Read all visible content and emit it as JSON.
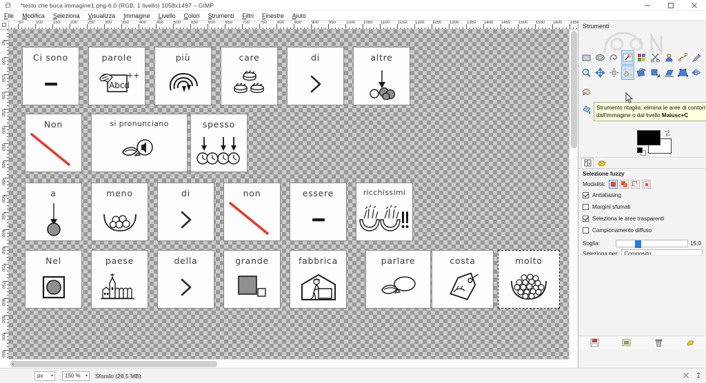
{
  "window": {
    "title": "*testo che buca immagine1.png-6.0 (RGB, 1 livello) 1058x1497 – GIMP",
    "app_icon": "gimp-icon",
    "minimize_label": "–",
    "maximize_label": "▢",
    "close_label": "✕"
  },
  "menubar": {
    "items": [
      {
        "label": "File"
      },
      {
        "label": "Modifica"
      },
      {
        "label": "Seleziona"
      },
      {
        "label": "Visualizza"
      },
      {
        "label": "Immagine"
      },
      {
        "label": "Livello"
      },
      {
        "label": "Colori"
      },
      {
        "label": "Strumenti"
      },
      {
        "label": "Filtri"
      },
      {
        "label": "Finestre"
      },
      {
        "label": "Aiuto"
      }
    ]
  },
  "rulers": {
    "horizontal_labels": [
      "50",
      "100",
      "150",
      "200",
      "250",
      "300",
      "350",
      "400",
      "450",
      "500",
      "550",
      "600",
      "650",
      "700",
      "750",
      "800",
      "850",
      "900",
      "950",
      "1000"
    ],
    "vertical_labels": [
      "50",
      "100",
      "150",
      "200",
      "250",
      "300",
      "350",
      "400",
      "450",
      "500",
      "550",
      "600",
      "650"
    ],
    "unit_step": 50
  },
  "canvas": {
    "cards": [
      {
        "label": "Ci sono",
        "icon": "minus-dash-icon",
        "row": 1,
        "selected": false
      },
      {
        "label": "parole",
        "icon": "hand-writing-abcd-icon",
        "row": 1,
        "selected": false
      },
      {
        "label": "più",
        "icon": "swirl-arcs-icon",
        "row": 1,
        "selected": false
      },
      {
        "label": "care",
        "icon": "coins-stacks-icon",
        "row": 1,
        "selected": false
      },
      {
        "label": "di",
        "icon": "greater-than-icon",
        "row": 1,
        "selected": false
      },
      {
        "label": "altre",
        "icon": "arrow-down-circles-icon",
        "row": 1,
        "selected": false
      },
      {
        "label": "Non",
        "icon": "red-slash-icon",
        "row": 2,
        "selected": false
      },
      {
        "label": "si pronunciano",
        "icon": "mouth-speaker-icon",
        "row": 2,
        "selected": false
      },
      {
        "label": "spesso",
        "icon": "arrows-clocks-icon",
        "row": 2,
        "selected": false
      },
      {
        "label": "a",
        "icon": "arrow-down-ball-icon",
        "row": 3,
        "selected": false
      },
      {
        "label": "meno",
        "icon": "bowl-few-balls-icon",
        "row": 3,
        "selected": false
      },
      {
        "label": "di",
        "icon": "greater-than-icon",
        "row": 3,
        "selected": false
      },
      {
        "label": "non",
        "icon": "red-slash-icon",
        "row": 3,
        "selected": false
      },
      {
        "label": "essere",
        "icon": "minus-dash-icon",
        "row": 3,
        "selected": false
      },
      {
        "label": "ricchissimi",
        "icon": "hands-money-excl-icon",
        "row": 3,
        "selected": false
      },
      {
        "label": "Nel",
        "icon": "square-in-square-icon",
        "row": 4,
        "selected": false
      },
      {
        "label": "paese",
        "icon": "village-church-icon",
        "row": 4,
        "selected": false
      },
      {
        "label": "della",
        "icon": "greater-than-icon",
        "row": 4,
        "selected": false
      },
      {
        "label": "grande",
        "icon": "big-small-square-icon",
        "row": 4,
        "selected": false
      },
      {
        "label": "fabbrica",
        "icon": "factory-worker-icon",
        "row": 4,
        "selected": false
      },
      {
        "label": "parlare",
        "icon": "mouth-bubble-icon",
        "row": 4,
        "selected": false
      },
      {
        "label": "costa",
        "icon": "price-tag-icon",
        "row": 4,
        "selected": false
      },
      {
        "label": "molto",
        "icon": "bowl-many-balls-icon",
        "row": 4,
        "selected": true
      }
    ]
  },
  "dock": {
    "title": "Strumenti",
    "tools_row1": [
      {
        "name": "rectangle-select-tool",
        "active": false
      },
      {
        "name": "ellipse-select-tool",
        "active": false
      },
      {
        "name": "free-select-tool",
        "active": false
      },
      {
        "name": "fuzzy-select-tool",
        "active": true
      },
      {
        "name": "select-by-color-tool",
        "active": false
      },
      {
        "name": "scissors-select-tool",
        "active": false
      },
      {
        "name": "foreground-select-tool",
        "active": false
      },
      {
        "name": "paths-tool",
        "active": false
      },
      {
        "name": "color-picker-tool",
        "active": false
      }
    ],
    "tools_row2": [
      {
        "name": "zoom-tool",
        "active": false
      },
      {
        "name": "move-tool",
        "active": false
      },
      {
        "name": "align-tool",
        "active": false
      },
      {
        "name": "crop-tool",
        "active": true
      },
      {
        "name": "rotate-tool",
        "active": false
      },
      {
        "name": "scale-tool",
        "active": false
      },
      {
        "name": "shear-tool",
        "active": false
      },
      {
        "name": "perspective-tool",
        "active": false
      },
      {
        "name": "flip-tool",
        "active": false
      }
    ],
    "tools_col": [
      {
        "name": "warp-transform-tool"
      },
      {
        "name": "bucket-fill-tool"
      }
    ],
    "tooltip": {
      "text": "Strumento ritaglia: elimina le aree di contorno dall'immagine o dal livello",
      "shortcut": "Maiusc+C"
    },
    "colors": {
      "foreground": "#000000",
      "background": "#ffffff",
      "swap_icon": "swap-colors-icon",
      "reset_icon": "reset-colors-icon"
    },
    "options_tabs": [
      {
        "name": "tool-options-tab"
      },
      {
        "name": "device-status-tab"
      }
    ],
    "options": {
      "heading": "Selezione fuzzy",
      "mode_label": "Modalità:",
      "modes": [
        {
          "name": "replace-selection-mode",
          "selected": true
        },
        {
          "name": "add-to-selection-mode",
          "selected": false
        },
        {
          "name": "subtract-selection-mode",
          "selected": false
        },
        {
          "name": "intersect-selection-mode",
          "selected": false
        }
      ],
      "checkboxes": [
        {
          "label": "Antialiasing",
          "checked": true
        },
        {
          "label": "Margini sfumati",
          "checked": false
        },
        {
          "label": "Seleziona le aree trasparenti",
          "checked": true
        },
        {
          "label": "Campionamento diffuso",
          "checked": false
        }
      ],
      "threshold_label": "Soglia:",
      "threshold_value": "15,0",
      "select_by_label": "Seleziona per:",
      "select_by_value": "Composito"
    },
    "bottom_buttons": [
      {
        "name": "save-tool-options-button"
      },
      {
        "name": "restore-tool-options-button"
      },
      {
        "name": "delete-tool-options-button"
      },
      {
        "name": "reset-tool-options-button"
      }
    ]
  },
  "statusbar": {
    "unit": "px",
    "zoom": "150 %",
    "layer_info": "Sfondo (28,5 MB)",
    "nav_left_icon": "scroll-left-icon"
  }
}
